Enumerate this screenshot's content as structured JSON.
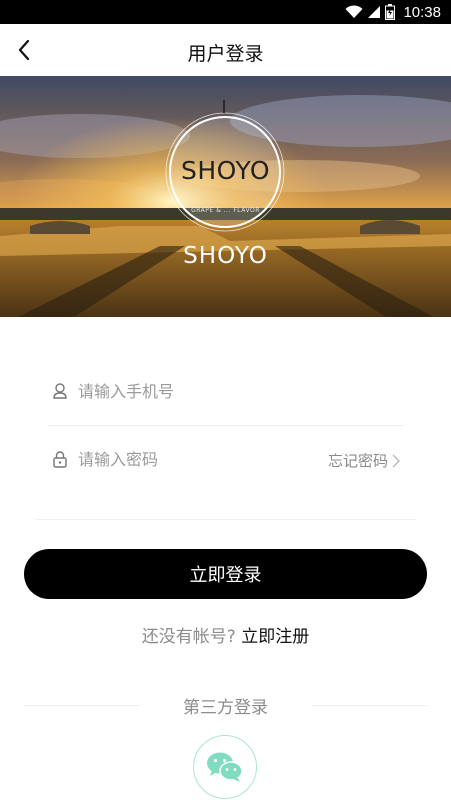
{
  "status_bar": {
    "time": "10:38",
    "battery_level": 0.7
  },
  "nav": {
    "title": "用户登录"
  },
  "hero": {
    "logo_text": "SHOYO",
    "logo_tagline": "GRAPE & ... FLAVOR",
    "brand_text": "SHOYO"
  },
  "form": {
    "phone_placeholder": "请输入手机号",
    "password_placeholder": "请输入密码",
    "forgot_label": "忘记密码"
  },
  "login_button": "立即登录",
  "register": {
    "prompt": "还没有帐号?",
    "link": "立即注册"
  },
  "third_party": {
    "label": "第三方登录"
  },
  "colors": {
    "accent": "#000000",
    "wechat": "#7fdcbf",
    "placeholder": "#9a9a9a"
  }
}
